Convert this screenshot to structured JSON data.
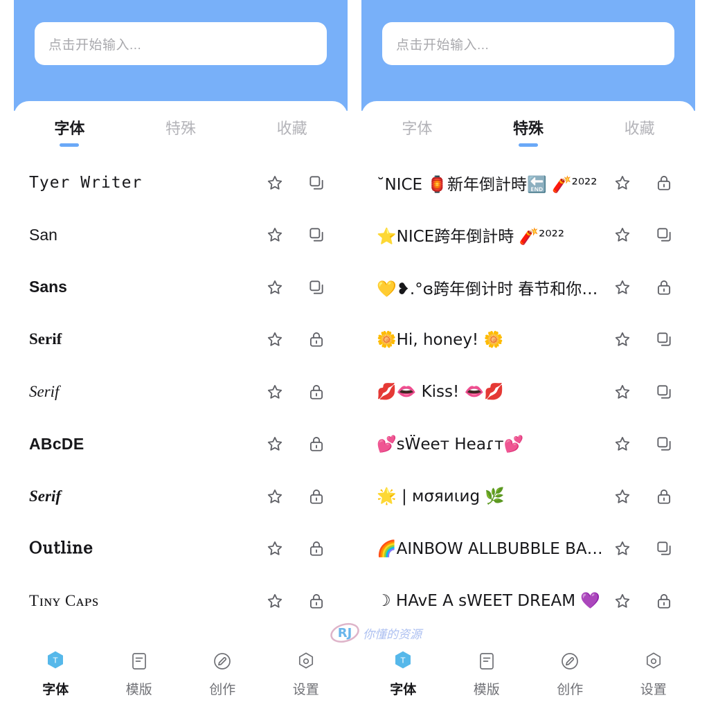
{
  "app": {
    "accent_color": "#6aa9f7",
    "header_color": "#78b0f9",
    "muted_color": "#b3b3b8"
  },
  "search": {
    "placeholder": "点击开始输入...",
    "value": ""
  },
  "tabs": [
    {
      "label": "字体"
    },
    {
      "label": "特殊"
    },
    {
      "label": "收藏"
    }
  ],
  "panels": [
    {
      "name": "font-panel",
      "active_tab_index": 0,
      "rows": [
        {
          "text": "Tyer Writer",
          "style": "f-mono",
          "star_icon": "star-outline-icon",
          "action_icon": "copy-icon"
        },
        {
          "text": "San",
          "style": "f-sans",
          "star_icon": "star-outline-icon",
          "action_icon": "copy-icon"
        },
        {
          "text": "Sans",
          "style": "f-sans-b",
          "star_icon": "star-outline-icon",
          "action_icon": "copy-icon"
        },
        {
          "text": "Serif",
          "style": "f-serif-b",
          "star_icon": "star-outline-icon",
          "action_icon": "lock-icon"
        },
        {
          "text": "Serif",
          "style": "f-serif-i",
          "star_icon": "star-outline-icon",
          "action_icon": "lock-icon"
        },
        {
          "text": "ABcDE",
          "style": "f-small",
          "star_icon": "star-outline-icon",
          "action_icon": "lock-icon"
        },
        {
          "text": "Serif",
          "style": "f-serif-bi",
          "star_icon": "star-outline-icon",
          "action_icon": "lock-icon"
        },
        {
          "text": "Outline",
          "style": "f-outline",
          "star_icon": "star-outline-icon",
          "action_icon": "lock-icon"
        },
        {
          "text": "Tɪɴʏ Cᴀᴘs",
          "style": "f-caps",
          "star_icon": "star-outline-icon",
          "action_icon": "lock-icon"
        }
      ]
    },
    {
      "name": "special-panel",
      "active_tab_index": 1,
      "rows": [
        {
          "text": "˘NICE 🏮新年倒計時🔚 🧨²⁰²²",
          "style": "f-special",
          "star_icon": "star-outline-icon",
          "action_icon": "lock-icon"
        },
        {
          "text": "⭐NICE跨年倒計時 🧨²⁰²²",
          "style": "f-special",
          "star_icon": "star-outline-icon",
          "action_icon": "copy-icon"
        },
        {
          "text": "💛❥.°ɞ跨年倒计时 春节和你ʚ°.❥...",
          "style": "f-special",
          "star_icon": "star-outline-icon",
          "action_icon": "lock-icon"
        },
        {
          "text": "🌼Hi, honey! 🌼",
          "style": "f-special",
          "star_icon": "star-outline-icon",
          "action_icon": "copy-icon"
        },
        {
          "text": "💋👄 Kiss! 👄💋",
          "style": "f-special",
          "star_icon": "star-outline-icon",
          "action_icon": "copy-icon"
        },
        {
          "text": "💕sẄeeт Heaɾт💕",
          "style": "f-special",
          "star_icon": "star-outline-icon",
          "action_icon": "copy-icon"
        },
        {
          "text": "🌟 | мσяиιиg 🌿",
          "style": "f-special",
          "star_icon": "star-outline-icon",
          "action_icon": "lock-icon"
        },
        {
          "text": "🌈AINBOW ALLBUBBLE BABE🌻",
          "style": "f-special",
          "star_icon": "star-outline-icon",
          "action_icon": "copy-icon"
        },
        {
          "text": "☽ HAvE A sWEET DREAM 💜",
          "style": "f-special",
          "star_icon": "star-outline-icon",
          "action_icon": "lock-icon"
        }
      ]
    }
  ],
  "bottom_nav": {
    "active_index": 0,
    "items": [
      {
        "label": "字体",
        "icon": "font-t-hexagon-icon"
      },
      {
        "label": "模版",
        "icon": "template-document-icon"
      },
      {
        "label": "创作",
        "icon": "pencil-circle-icon"
      },
      {
        "label": "设置",
        "icon": "gear-hexagon-icon"
      }
    ]
  },
  "watermark": {
    "logo_text": "RJ",
    "text": "你懂的资源"
  }
}
